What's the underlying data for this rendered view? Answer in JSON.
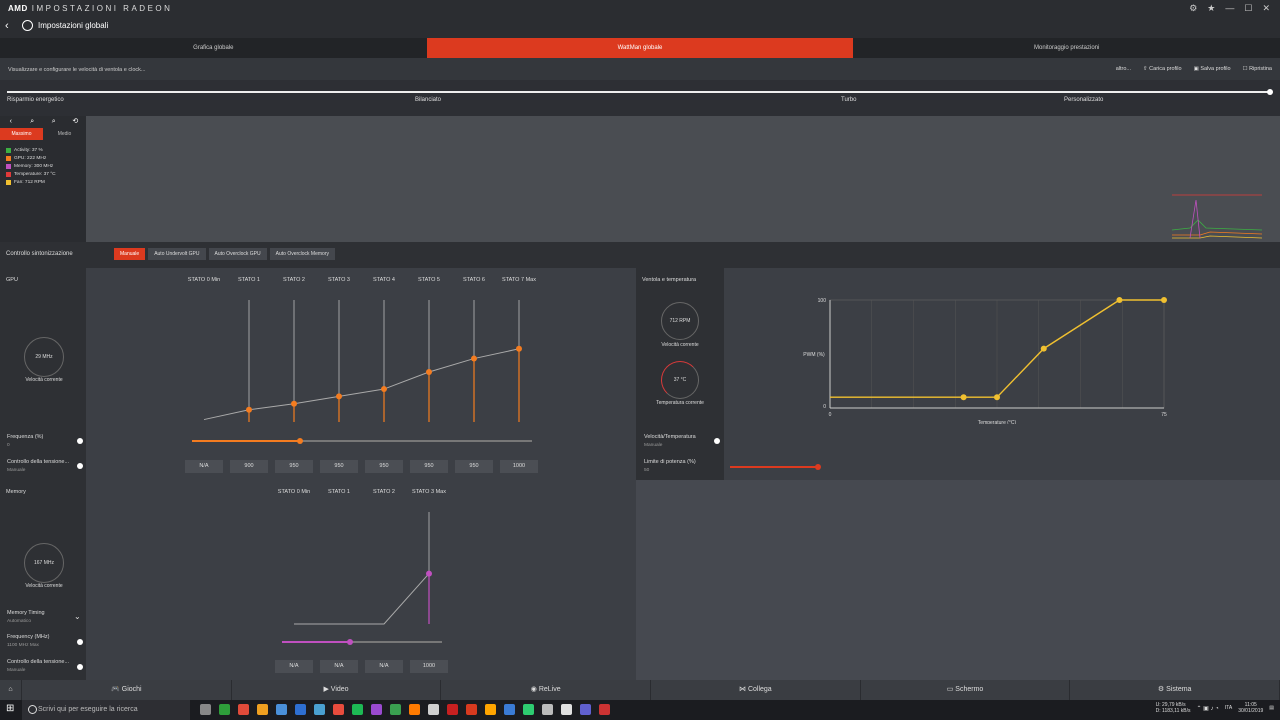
{
  "app": {
    "brand": "AMD",
    "product": "IMPOSTAZIONI RADEON",
    "page_title": "Impostazioni globali"
  },
  "tabs": [
    "Grafica globale",
    "WattMan globale",
    "Monitoraggio prestazioni"
  ],
  "description": "Visualizzare e configurare le velocità di ventola e clock...",
  "actions": {
    "more": "altro...",
    "load": "Carica profilo",
    "save": "Salva profilo",
    "reset": "Ripristina"
  },
  "presets": [
    "Risparmio energetico",
    "Bilanciato",
    "Turbo",
    "Personalizzato"
  ],
  "graph": {
    "tabs": [
      "Massimo",
      "Medio"
    ],
    "legend": [
      {
        "label": "Activity: 37 %",
        "color": "#3cb043"
      },
      {
        "label": "GPU: 222 MHz",
        "color": "#f47c20"
      },
      {
        "label": "Memory: 300 MHz",
        "color": "#c050c0"
      },
      {
        "label": "Temperature: 37 °C",
        "color": "#e03a3a"
      },
      {
        "label": "Fan: 712 RPM",
        "color": "#f0c030"
      }
    ]
  },
  "tuning": {
    "label": "Controllo sintonizzazione",
    "modes": [
      "Manuale",
      "Auto Undervolt GPU",
      "Auto Overclock GPU",
      "Auto Overclock Memory"
    ]
  },
  "gpu": {
    "header": "GPU",
    "states": [
      "STATO 0 Min",
      "STATO 1",
      "STATO 2",
      "STATO 3",
      "STATO 4",
      "STATO 5",
      "STATO 6",
      "STATO 7 Max"
    ],
    "gauge_value": "29 MHz",
    "gauge_label": "Velocità corrente",
    "freq_label": "Frequenza (%)",
    "freq_value": "0",
    "volt_label": "Controllo della tensione...",
    "volt_mode": "Manuale",
    "voltages": [
      "N/A",
      "900",
      "950",
      "950",
      "950",
      "950",
      "950",
      "1000"
    ]
  },
  "fan": {
    "header": "Ventola e temperatura",
    "rpm": "712 RPM",
    "rpm_label": "Velocità corrente",
    "temp": "37 °C",
    "temp_label": "Temperatura corrente",
    "speed_temp_label": "Velocità/Temperatura",
    "speed_temp_mode": "Manuale",
    "power_label": "Limite di potenza (%)",
    "power_value": "50",
    "chart_ylabel": "PWM (%)",
    "chart_xlabel": "Temperature (°C)",
    "y_top": "100",
    "y_bottom": "0",
    "x_left": "0",
    "x_right": "75"
  },
  "memory": {
    "header": "Memory",
    "states": [
      "STATO 0 Min",
      "STATO 1",
      "STATO 2",
      "STATO 3 Max"
    ],
    "gauge_value": "167 MHz",
    "gauge_label": "Velocità corrente",
    "timing_label": "Memory Timing",
    "timing_mode": "Automatico",
    "freq_label": "Frequency (MHz)",
    "freq_value": "1100 MHz Max",
    "volt_label": "Controllo della tensione...",
    "volt_mode": "Manuale",
    "voltages": [
      "N/A",
      "N/A",
      "N/A",
      "1000"
    ]
  },
  "apptabs": [
    "Giochi",
    "Video",
    "ReLive",
    "Collega",
    "Schermo",
    "Sistema"
  ],
  "taskbar": {
    "search": "Scrivi qui per eseguire la ricerca",
    "upload": "U: 29,79 kB/s",
    "download": "D: 1183,11 kB/s",
    "lang": "ITA",
    "time": "11:05",
    "date": "30/01/2019"
  },
  "colors": {
    "accent": "#dc3a1f",
    "gpu": "#f47c20",
    "memory": "#c050c0",
    "fan": "#f0c030"
  }
}
